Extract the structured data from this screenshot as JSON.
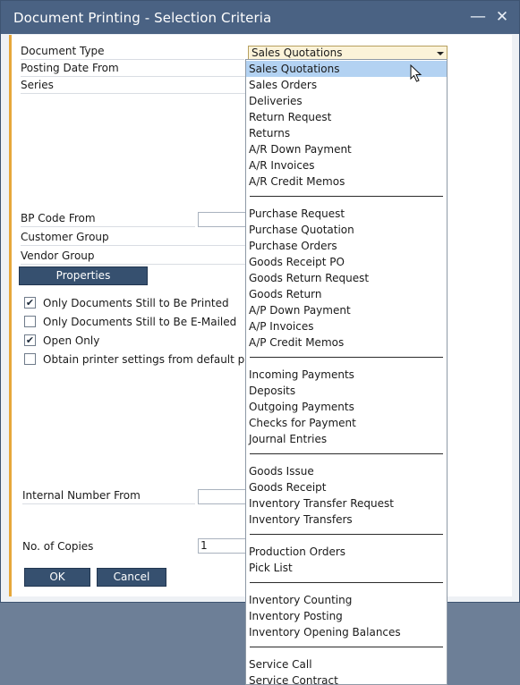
{
  "window": {
    "title": "Document Printing - Selection Criteria",
    "minimize_glyph": "—",
    "close_glyph": "✕"
  },
  "form": {
    "document_type_label": "Document Type",
    "document_type_value": "Sales Quotations",
    "posting_date_from_label": "Posting Date From",
    "series_label": "Series",
    "bp_code_from_label": "BP Code From",
    "customer_group_label": "Customer Group",
    "vendor_group_label": "Vendor Group",
    "properties_button": "Properties",
    "checkboxes": [
      {
        "label": "Only Documents Still to Be Printed",
        "checked": true
      },
      {
        "label": "Only Documents Still to Be E-Mailed",
        "checked": false
      },
      {
        "label": "Open Only",
        "checked": true
      },
      {
        "label": "Obtain printer settings from default printing",
        "checked": false
      }
    ],
    "internal_number_from_label": "Internal Number From",
    "copies_label": "No. of Copies",
    "copies_value": "1",
    "ok_button": "OK",
    "cancel_button": "Cancel"
  },
  "dropdown": {
    "selected_index": 0,
    "groups": [
      [
        "Sales Quotations",
        "Sales Orders",
        "Deliveries",
        "Return Request",
        "Returns",
        "A/R Down Payment",
        "A/R Invoices",
        "A/R Credit Memos"
      ],
      [
        "Purchase Request",
        "Purchase Quotation",
        "Purchase Orders",
        "Goods Receipt PO",
        "Goods Return Request",
        "Goods Return",
        "A/P Down Payment",
        "A/P Invoices",
        "A/P Credit Memos"
      ],
      [
        "Incoming Payments",
        "Deposits",
        "Outgoing Payments",
        "Checks for Payment",
        "Journal Entries"
      ],
      [
        "Goods Issue",
        "Goods Receipt",
        "Inventory Transfer Request",
        "Inventory Transfers"
      ],
      [
        "Production Orders",
        "Pick List"
      ],
      [
        "Inventory Counting",
        "Inventory Posting",
        "Inventory Opening Balances"
      ],
      [
        "Service Call",
        "Service Contract"
      ]
    ]
  },
  "colors": {
    "titlebar": "#4a6283",
    "accent": "#e6a73a",
    "button": "#36506f",
    "selection": "#b3d2f2"
  }
}
